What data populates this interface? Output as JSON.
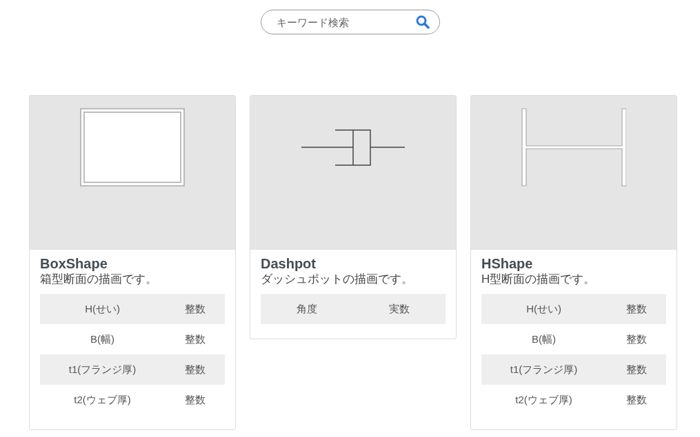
{
  "search": {
    "placeholder": "キーワード検索"
  },
  "cards": [
    {
      "kind": "box",
      "title": "BoxShape",
      "description": "箱型断面の描画です。",
      "params": [
        [
          "H(せい)",
          "整数"
        ],
        [
          "B(幅)",
          "整数"
        ],
        [
          "t1(フランジ厚)",
          "整数"
        ],
        [
          "t2(ウェブ厚)",
          "整数"
        ]
      ]
    },
    {
      "kind": "dashpot",
      "title": "Dashpot",
      "description": "ダッシュポットの描画です。",
      "params": [
        [
          "角度",
          "実数"
        ]
      ]
    },
    {
      "kind": "h",
      "title": "HShape",
      "description": "H型断面の描画です。",
      "params": [
        [
          "H(せい)",
          "整数"
        ],
        [
          "B(幅)",
          "整数"
        ],
        [
          "t1(フランジ厚)",
          "整数"
        ],
        [
          "t2(ウェブ厚)",
          "整数"
        ]
      ]
    }
  ]
}
